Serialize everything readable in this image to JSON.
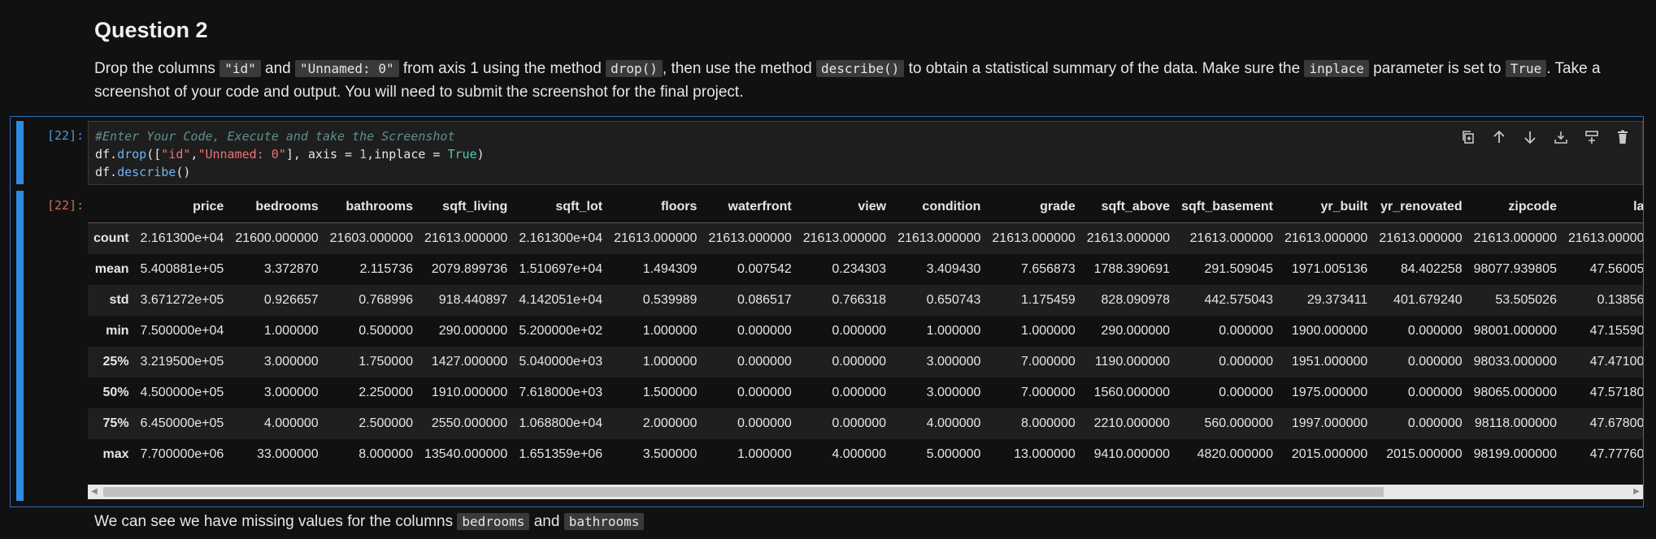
{
  "question": {
    "title": "Question 2",
    "desc_1": "Drop the columns ",
    "code_id": "\"id\"",
    "desc_2": " and ",
    "code_unnamed": "\"Unnamed: 0\"",
    "desc_3": " from axis 1 using the method ",
    "code_drop": "drop()",
    "desc_4": ", then use the method ",
    "code_describe": "describe()",
    "desc_5": " to obtain a statistical summary of the data. Make sure the ",
    "code_inplace": "inplace",
    "desc_6": " parameter is set to ",
    "code_true": "True",
    "desc_7": ". Take a screenshot of your code and output. You will need to submit the screenshot for the final project."
  },
  "cell": {
    "in_prompt": "[22]:",
    "out_prompt": "[22]:",
    "code": {
      "comment": "#Enter Your Code, Execute and take the Screenshot",
      "l2_a": "df.",
      "l2_fn": "drop",
      "l2_b": "([",
      "l2_s1": "\"id\"",
      "l2_c": ",",
      "l2_s2": "\"Unnamed: 0\"",
      "l2_d": "], axis = ",
      "l2_n": "1",
      "l2_e": ",inplace = ",
      "l2_kw": "True",
      "l2_f": ")",
      "l3_a": "df.",
      "l3_fn": "describe",
      "l3_b": "()"
    },
    "toolbar": [
      "copy-icon",
      "arrow-up-icon",
      "arrow-down-icon",
      "insert-above-icon",
      "insert-below-icon",
      "delete-icon"
    ]
  },
  "table": {
    "columns": [
      "",
      "price",
      "bedrooms",
      "bathrooms",
      "sqft_living",
      "sqft_lot",
      "floors",
      "waterfront",
      "view",
      "condition",
      "grade",
      "sqft_above",
      "sqft_basement",
      "yr_built",
      "yr_renovated",
      "zipcode",
      "la"
    ],
    "rows": [
      [
        "count",
        "2.161300e+04",
        "21600.000000",
        "21603.000000",
        "21613.000000",
        "2.161300e+04",
        "21613.000000",
        "21613.000000",
        "21613.000000",
        "21613.000000",
        "21613.000000",
        "21613.000000",
        "21613.000000",
        "21613.000000",
        "21613.000000",
        "21613.000000",
        "21613.00000"
      ],
      [
        "mean",
        "5.400881e+05",
        "3.372870",
        "2.115736",
        "2079.899736",
        "1.510697e+04",
        "1.494309",
        "0.007542",
        "0.234303",
        "3.409430",
        "7.656873",
        "1788.390691",
        "291.509045",
        "1971.005136",
        "84.402258",
        "98077.939805",
        "47.56005"
      ],
      [
        "std",
        "3.671272e+05",
        "0.926657",
        "0.768996",
        "918.440897",
        "4.142051e+04",
        "0.539989",
        "0.086517",
        "0.766318",
        "0.650743",
        "1.175459",
        "828.090978",
        "442.575043",
        "29.373411",
        "401.679240",
        "53.505026",
        "0.13856"
      ],
      [
        "min",
        "7.500000e+04",
        "1.000000",
        "0.500000",
        "290.000000",
        "5.200000e+02",
        "1.000000",
        "0.000000",
        "0.000000",
        "1.000000",
        "1.000000",
        "290.000000",
        "0.000000",
        "1900.000000",
        "0.000000",
        "98001.000000",
        "47.15590"
      ],
      [
        "25%",
        "3.219500e+05",
        "3.000000",
        "1.750000",
        "1427.000000",
        "5.040000e+03",
        "1.000000",
        "0.000000",
        "0.000000",
        "3.000000",
        "7.000000",
        "1190.000000",
        "0.000000",
        "1951.000000",
        "0.000000",
        "98033.000000",
        "47.47100"
      ],
      [
        "50%",
        "4.500000e+05",
        "3.000000",
        "2.250000",
        "1910.000000",
        "7.618000e+03",
        "1.500000",
        "0.000000",
        "0.000000",
        "3.000000",
        "7.000000",
        "1560.000000",
        "0.000000",
        "1975.000000",
        "0.000000",
        "98065.000000",
        "47.57180"
      ],
      [
        "75%",
        "6.450000e+05",
        "4.000000",
        "2.500000",
        "2550.000000",
        "1.068800e+04",
        "2.000000",
        "0.000000",
        "0.000000",
        "4.000000",
        "8.000000",
        "2210.000000",
        "560.000000",
        "1997.000000",
        "0.000000",
        "98118.000000",
        "47.67800"
      ],
      [
        "max",
        "7.700000e+06",
        "33.000000",
        "8.000000",
        "13540.000000",
        "1.651359e+06",
        "3.500000",
        "1.000000",
        "4.000000",
        "5.000000",
        "13.000000",
        "9410.000000",
        "4820.000000",
        "2015.000000",
        "2015.000000",
        "98199.000000",
        "47.77760"
      ]
    ]
  },
  "footer": {
    "text_1": "We can see we have missing values for the columns ",
    "code_bedrooms": "bedrooms",
    "text_2": " and ",
    "code_bathrooms": "bathrooms"
  }
}
